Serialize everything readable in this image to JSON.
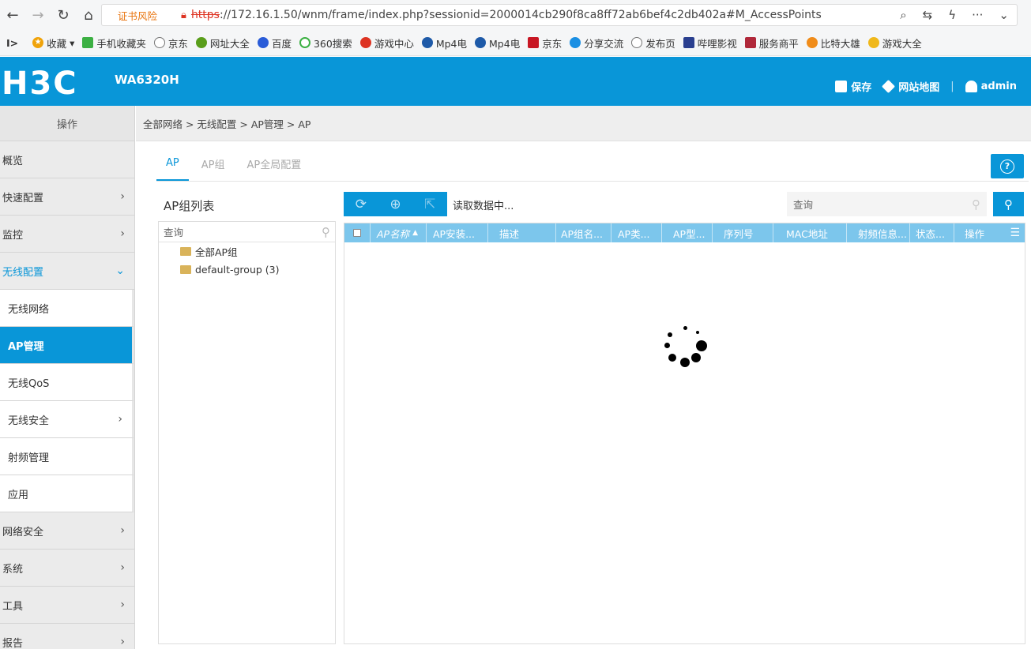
{
  "browser": {
    "cert_warning": "证书风险",
    "url_protocol": "https",
    "url_rest": "://172.16.1.50/wnm/frame/index.php?sessionid=2000014cb290f8ca8ff72ab6bef4c2db402a#M_AccessPoints",
    "bookmarks": [
      "收藏",
      "手机收藏夹",
      "京东",
      "网址大全",
      "百度",
      "360搜索",
      "游戏中心",
      "Mp4电",
      "Mp4电",
      "京东",
      "分享交流",
      "发布页",
      "哔哩影视",
      "服务商平",
      "比特大雄",
      "游戏大全"
    ]
  },
  "header": {
    "logo": "H3C",
    "model": "WA6320H",
    "save_label": "保存",
    "sitemap_label": "网站地图",
    "separator": "|",
    "user_label": "admin"
  },
  "sidebar": {
    "title": "操作",
    "items": [
      {
        "label": "概览",
        "chevron": ""
      },
      {
        "label": "快速配置",
        "chevron": "›"
      },
      {
        "label": "监控",
        "chevron": "›"
      },
      {
        "label": "无线配置",
        "chevron": "⌄"
      }
    ],
    "subitems": [
      {
        "label": "无线网络"
      },
      {
        "label": "AP管理"
      },
      {
        "label": "无线QoS"
      },
      {
        "label": "无线安全",
        "chevron": "›"
      },
      {
        "label": "射频管理"
      },
      {
        "label": "应用"
      }
    ],
    "bottom_items": [
      {
        "label": "网络安全",
        "chevron": "›"
      },
      {
        "label": "系统",
        "chevron": "›"
      },
      {
        "label": "工具",
        "chevron": "›"
      },
      {
        "label": "报告",
        "chevron": "›"
      }
    ]
  },
  "breadcrumb": "全部网络 > 无线配置 > AP管理 > AP",
  "tabs": [
    {
      "label": "AP"
    },
    {
      "label": "AP组"
    },
    {
      "label": "AP全局配置"
    }
  ],
  "help_label": "?",
  "group_panel": {
    "title": "AP组列表",
    "search_placeholder": "查询",
    "nodes": [
      {
        "label": "全部AP组"
      },
      {
        "label": "default-group (3)"
      }
    ]
  },
  "table": {
    "loading_text": "读取数据中...",
    "search_placeholder": "查询",
    "columns": [
      "AP名称",
      "AP安装...",
      "描述",
      "AP组名...",
      "AP类...",
      "AP型...",
      "序列号",
      "MAC地址",
      "射频信息...",
      "状态...",
      "操作"
    ]
  }
}
